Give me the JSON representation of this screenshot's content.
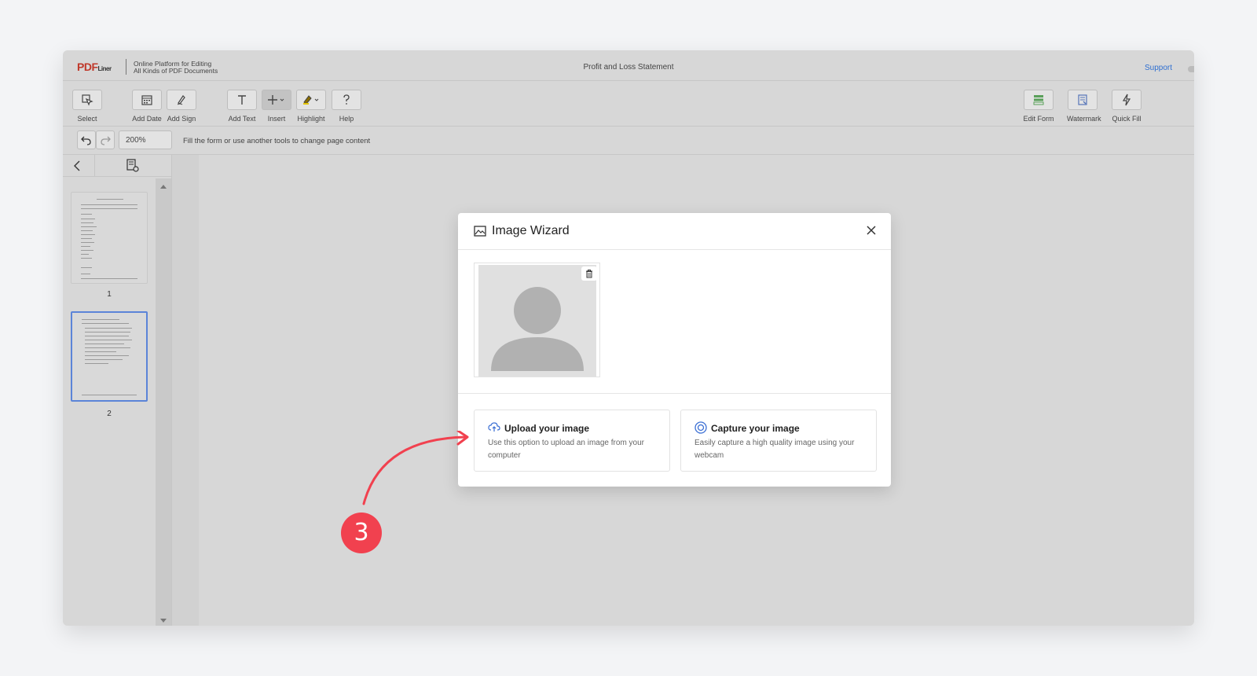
{
  "app": {
    "logo_main": "PDF",
    "logo_sub": "Liner",
    "tagline_1": "Online Platform for Editing",
    "tagline_2": "All Kinds of PDF Documents",
    "document_title": "Profit and Loss Statement",
    "support_label": "Support"
  },
  "toolbar": {
    "select": "Select",
    "add_date": "Add Date",
    "add_sign": "Add Sign",
    "add_text": "Add Text",
    "insert": "Insert",
    "highlight": "Highlight",
    "help": "Help",
    "edit_form": "Edit Form",
    "watermark": "Watermark",
    "quick_fill": "Quick Fill"
  },
  "subbar": {
    "zoom": "200%",
    "hint": "Fill the form or use another tools to change page content"
  },
  "sidebar": {
    "pages": [
      {
        "number": "1",
        "selected": false
      },
      {
        "number": "2",
        "selected": true
      }
    ]
  },
  "modal": {
    "title": "Image Wizard",
    "upload": {
      "title": "Upload your image",
      "description": "Use this option to upload an image from your computer"
    },
    "capture": {
      "title": "Capture your image",
      "description": "Easily capture a high quality image using your webcam"
    }
  },
  "annotation": {
    "step": "3",
    "color": "#f1414f"
  }
}
